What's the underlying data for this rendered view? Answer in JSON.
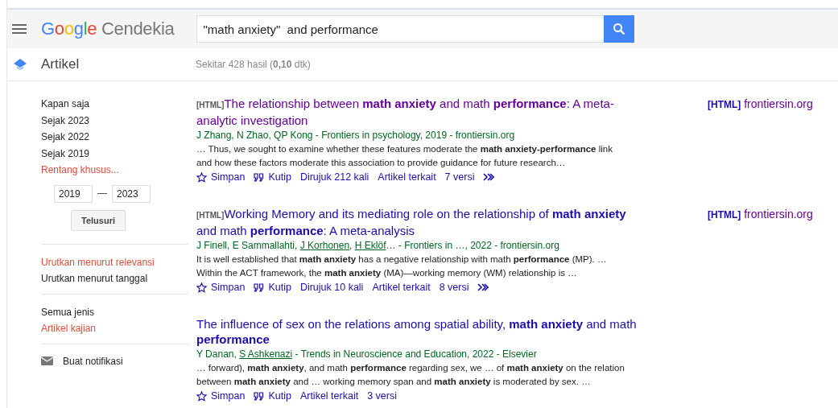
{
  "header": {
    "logo_brand": "Google",
    "logo_product": "Cendekia",
    "search": {
      "value": "\"math anxiety\"  and performance"
    }
  },
  "subheader": {
    "section": "Artikel",
    "stats": "Sekitar 428 hasil (**0,10** dtk)"
  },
  "sidebar": {
    "groups": [
      {
        "kind": "links",
        "items": [
          {
            "label": "Kapan saja",
            "selected": false
          },
          {
            "label": "Sejak 2023",
            "selected": false
          },
          {
            "label": "Sejak 2022",
            "selected": false
          },
          {
            "label": "Sejak 2019",
            "selected": false
          },
          {
            "label": "Rentang khusus...",
            "selected": true
          }
        ],
        "range": {
          "from": "2019",
          "to": "2023",
          "button": "Telusuri"
        }
      },
      {
        "kind": "links",
        "items": [
          {
            "label": "Urutkan menurut relevansi",
            "selected": true
          },
          {
            "label": "Urutkan menurut tanggal",
            "selected": false
          }
        ]
      },
      {
        "kind": "links",
        "items": [
          {
            "label": "Semua jenis",
            "selected": false
          },
          {
            "label": "Artikel kajian",
            "selected": true
          }
        ]
      },
      {
        "kind": "alert",
        "items": [
          {
            "label": "Buat notifikasi",
            "selected": false
          }
        ]
      }
    ]
  },
  "results": [
    {
      "tag": "[HTML]",
      "title": "The relationship between **math anxiety** and math **performance**: A meta-analytic investigation",
      "visited": true,
      "source": [
        {
          "text": "J Zhang, N Zhao, QP Kong - Frontiers in psychology, 2019 - frontiersin.org",
          "linked": false
        }
      ],
      "snippet": "… Thus, we sought to examine whether these features moderate the **math anxiety-performance** link and how these factors moderate this association to provide guidance for future research…",
      "actions": [
        {
          "kind": "save",
          "label": "Simpan"
        },
        {
          "kind": "cite",
          "label": "Kutip"
        },
        {
          "kind": "link",
          "label": "Dirujuk 212 kali"
        },
        {
          "kind": "link",
          "label": "Artikel terkait"
        },
        {
          "kind": "link",
          "label": "7 versi"
        },
        {
          "kind": "more"
        }
      ],
      "side_link": {
        "tag": "[HTML]",
        "label": "frontiersin.org"
      }
    },
    {
      "tag": "[HTML]",
      "title": "Working Memory and its mediating role on the relationship of **math anxiety** and math **performance**: A meta-analysis",
      "visited": false,
      "source": [
        {
          "text": "J Finell, E Sammallahti, ",
          "linked": false
        },
        {
          "text": "J Korhonen",
          "linked": true
        },
        {
          "text": ", ",
          "linked": false
        },
        {
          "text": "H Eklöf",
          "linked": true
        },
        {
          "text": "… - Frontiers in …, 2022 - frontiersin.org",
          "linked": false
        }
      ],
      "snippet": "It is well established that **math anxiety** has a negative relationship with math **performance** (MP). … Within the ACT framework, the **math anxiety** (MA)—working memory (WM) relationship is …",
      "actions": [
        {
          "kind": "save",
          "label": "Simpan"
        },
        {
          "kind": "cite",
          "label": "Kutip"
        },
        {
          "kind": "link",
          "label": "Dirujuk 10 kali"
        },
        {
          "kind": "link",
          "label": "Artikel terkait"
        },
        {
          "kind": "link",
          "label": "8 versi"
        },
        {
          "kind": "more"
        }
      ],
      "side_link": {
        "tag": "[HTML]",
        "label": "frontiersin.org"
      }
    },
    {
      "title": "The influence of sex on the relations among spatial ability, **math anxiety** and math **performance**",
      "visited": false,
      "source": [
        {
          "text": "Y Danan, ",
          "linked": false
        },
        {
          "text": "S Ashkenazi",
          "linked": true
        },
        {
          "text": " - Trends in Neuroscience and Education, 2022 - Elsevier",
          "linked": false
        }
      ],
      "snippet": "… forward), **math anxiety**, and math **performance** regarding sex, we … of **math anxiety** on the relation between **math anxiety** and … working memory span and **math anxiety** is moderated by sex. …",
      "actions": [
        {
          "kind": "save",
          "label": "Simpan"
        },
        {
          "kind": "cite",
          "label": "Kutip"
        },
        {
          "kind": "link",
          "label": "Artikel terkait"
        },
        {
          "kind": "link",
          "label": "3 versi"
        }
      ]
    }
  ]
}
